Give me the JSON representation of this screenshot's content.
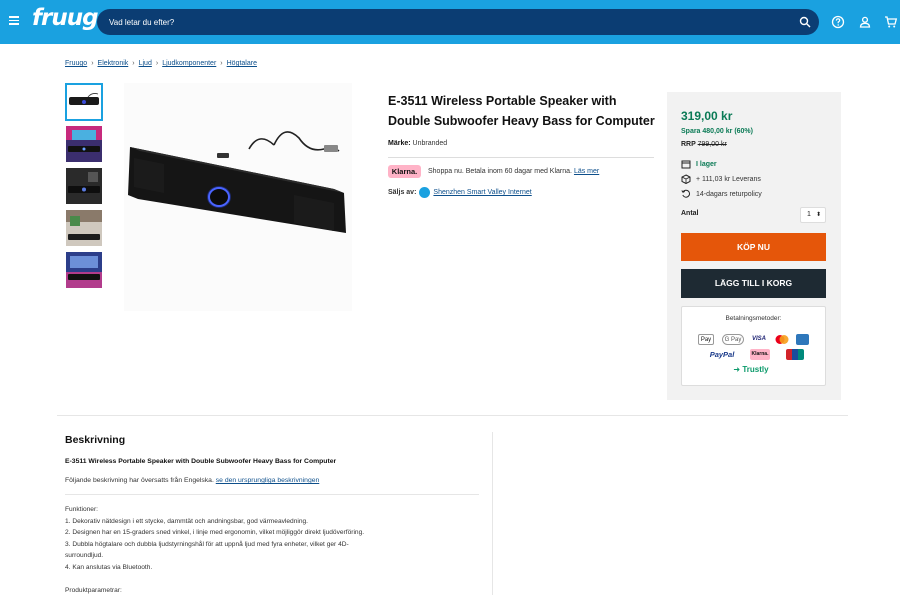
{
  "header": {
    "logo": "fruugo",
    "search_placeholder": "Vad letar du efter?"
  },
  "breadcrumb": [
    "Fruugo",
    "Elektronik",
    "Ljud",
    "Ljudkomponenter",
    "Högtalare"
  ],
  "product": {
    "title": "E-3511 Wireless Portable Speaker with Double Subwoofer Heavy Bass for Computer",
    "brand_label": "Märke:",
    "brand_value": "Unbranded",
    "klarna_badge": "Klarna.",
    "klarna_text": "Shoppa nu. Betala inom 60 dagar med Klarna.",
    "klarna_link": "Läs mer",
    "seller_label": "Säljs av:",
    "seller_name": "Shenzhen Smart Valley Internet"
  },
  "buybox": {
    "price": "319,00 kr",
    "save": "Spara 480,00 kr (60%)",
    "rrp_label": "RRP",
    "rrp_value": "799,00 kr",
    "stock": "I lager",
    "delivery": "+ 111,03 kr Leverans",
    "returns": "14-dagars returpolicy",
    "qty_label": "Antal",
    "qty_value": "1",
    "buy_now": "KÖP NU",
    "add_to_cart": "LÄGG TILL I KORG",
    "payment_title": "Betalningsmetoder:",
    "payment_methods": [
      "Pay",
      "G Pay",
      "VISA",
      "PayPal",
      "Klarna.",
      "Trustly"
    ]
  },
  "description": {
    "heading": "Beskrivning",
    "subtitle": "E-3511 Wireless Portable Speaker with Double Subwoofer Heavy Bass for Computer",
    "translated_note": "Följande beskrivning har översatts från Engelska.",
    "original_link": "se den ursprungliga beskrivningen",
    "body_lines": [
      "Funktioner:",
      "1. Dekorativ nätdesign i ett stycke, dammtät och andningsbar, god värmeavledning.",
      "2. Designen har en 15-graders sned vinkel, i linje med ergonomin, vilket möjliggör direkt ljudöverföring.",
      "3. Dubbla högtalare och dubbla ljudstyrningshål för att uppnå ljud med fyra enheter, vilket ger 4D-",
      "surroundljud.",
      "4. Kan anslutas via Bluetooth.",
      "",
      "Produktparametrar:"
    ]
  },
  "colors": {
    "header_bg": "#1aa1e0",
    "search_bg": "#0b3d73",
    "price_green": "#0a7a55",
    "buy_orange": "#e5560a",
    "cart_dark": "#1e2a33",
    "link_blue": "#0d4f8b"
  }
}
